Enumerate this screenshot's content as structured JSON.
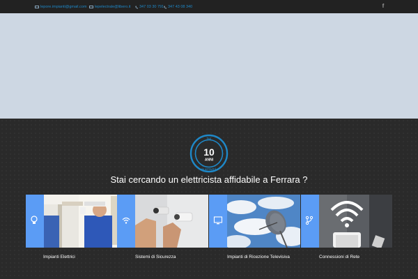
{
  "topbar": {
    "email1": "lepore.impianti@gmail.com",
    "email2": "lepelectrale@libero.it",
    "phone1": "347 03 30 791",
    "phone2": "347 43 08 340",
    "social_icon": "facebook-icon"
  },
  "badge": {
    "top": "DA",
    "number": "10",
    "unit": "ANNI",
    "bottom": "IN ATTIVITÀ",
    "color": "#1e88c8"
  },
  "heading": "Stai cercando un elettricista affidabile a Ferrara ?",
  "services": [
    {
      "label": "Impianti Elettrici",
      "icon": "lightbulb-icon"
    },
    {
      "label": "Sistemi di Sicurezza",
      "icon": "wifi-icon"
    },
    {
      "label": "Impianti di Ricezione Televisiva",
      "icon": "monitor-icon"
    },
    {
      "label": "Connessioni di Rete",
      "icon": "network-icon"
    }
  ],
  "colors": {
    "accent_bar": "#5b9cf5",
    "hero": "#cdd7e3",
    "section_bg": "#2a2a2a",
    "link": "#1e88c8"
  }
}
